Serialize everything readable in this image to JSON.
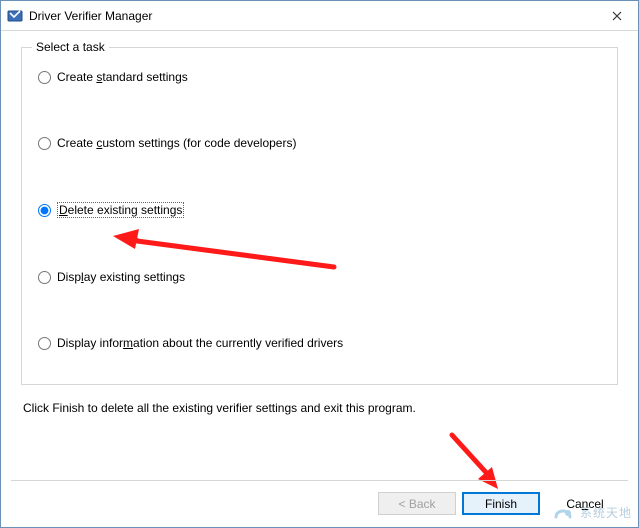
{
  "window": {
    "title": "Driver Verifier Manager"
  },
  "group": {
    "legend": "Select a task"
  },
  "options": {
    "standard": {
      "pre": "Create ",
      "u": "s",
      "post": "tandard settings"
    },
    "custom": {
      "pre": "Create ",
      "u": "c",
      "post": "ustom settings (for code developers)"
    },
    "delete": {
      "pre": "",
      "u": "D",
      "post": "elete existing settings"
    },
    "display": {
      "pre": "Disp",
      "u": "l",
      "post": "ay existing settings"
    },
    "info": {
      "pre": "Display infor",
      "u": "m",
      "post": "ation about the currently verified drivers"
    }
  },
  "hint": "Click Finish to delete all the existing verifier settings and exit this program.",
  "buttons": {
    "back": {
      "pre": "< ",
      "u": "B",
      "post": "ack"
    },
    "finish": {
      "label": "Finish"
    },
    "cancel": {
      "pre": "Ca",
      "u": "n",
      "post": "cel"
    }
  },
  "watermark": {
    "text": "系统天地"
  }
}
